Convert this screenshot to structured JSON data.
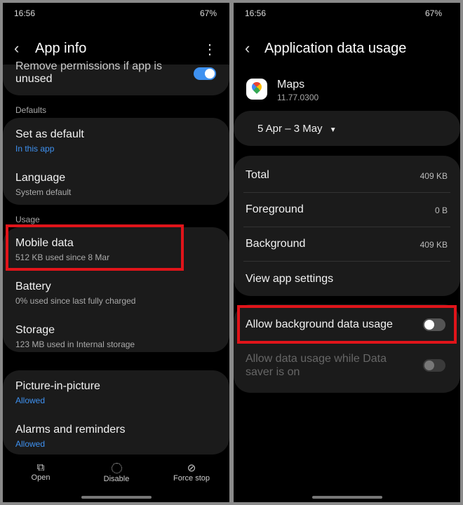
{
  "status": {
    "time": "16:56",
    "battery": "67%",
    "icons": [
      "gallery-icon",
      "account-icon",
      "checkbox-icon",
      "dot-icon",
      "mute-icon",
      "wifi-icon",
      "signal-icon",
      "battery-icon"
    ]
  },
  "left": {
    "title": "App info",
    "top_item": {
      "label_partial": "Remove permissions if app is",
      "label_end": "unused",
      "toggle_on": true
    },
    "defaults_header": "Defaults",
    "defaults": [
      {
        "label": "Set as default",
        "sub": "In this app"
      },
      {
        "label": "Language",
        "sub": "System default"
      }
    ],
    "usage_header": "Usage",
    "usage": [
      {
        "label": "Mobile data",
        "sub": "512 KB used since 8 Mar"
      },
      {
        "label": "Battery",
        "sub": "0% used since last fully charged"
      },
      {
        "label": "Storage",
        "sub": "123 MB used in Internal storage"
      }
    ],
    "more": [
      {
        "label": "Picture-in-picture",
        "sub": "Allowed"
      },
      {
        "label": "Alarms and reminders",
        "sub": "Allowed"
      }
    ],
    "bottom": [
      {
        "label": "Open",
        "icon": "open-external-icon"
      },
      {
        "label": "Disable",
        "icon": "disable-icon"
      },
      {
        "label": "Force stop",
        "icon": "force-stop-icon"
      }
    ]
  },
  "right": {
    "title": "Application data usage",
    "app": {
      "name": "Maps",
      "version": "11.77.0300"
    },
    "date_range": "5 Apr – 3 May",
    "rows": [
      {
        "label": "Total",
        "value": "409 KB"
      },
      {
        "label": "Foreground",
        "value": "0 B"
      },
      {
        "label": "Background",
        "value": "409 KB"
      }
    ],
    "view_settings": "View app settings",
    "allow_bg": {
      "label": "Allow background data usage",
      "on": false
    },
    "allow_saver": {
      "label": "Allow data usage while Data saver is on",
      "on": false
    }
  },
  "colors": {
    "accent": "#3e91f0",
    "highlight": "#e0141a",
    "card": "#1b1b1b"
  }
}
